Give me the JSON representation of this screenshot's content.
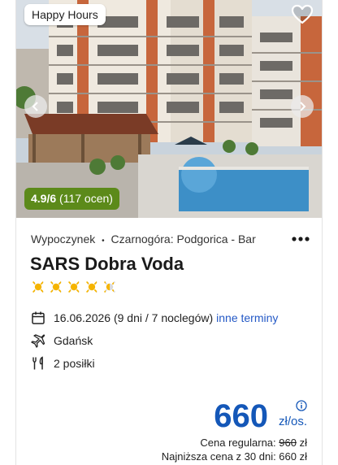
{
  "offer": {
    "badge": "Happy Hours",
    "rating_score": "4.9/6",
    "rating_count": "(117 ocen)",
    "category": "Wypoczynek",
    "separator": "•",
    "location": "Czarnogóra: Podgorica - Bar",
    "hotel_name": "SARS Dobra Voda",
    "sun_rating": 4.5,
    "sun_rating_max": 5,
    "date": "16.06.2026 (9 dni / 7 noclegów)",
    "date_link": "inne terminy",
    "departure": "Gdańsk",
    "meals": "2 posiłki",
    "price": "660",
    "price_unit": "zł/os.",
    "regular_label": "Cena regularna:",
    "regular_price": "960",
    "regular_currency": "zł",
    "lowest_label": "Najniższa cena z 30 dni: 660 zł"
  },
  "colors": {
    "accent": "#1457b8",
    "rating_bg": "#5c8a1a",
    "link": "#2459c6",
    "sun": "#f5b400"
  },
  "icons": {
    "favorite": "heart-icon",
    "prev": "chevron-left-icon",
    "next": "chevron-right-icon",
    "menu": "more-dots-icon",
    "date": "calendar-icon",
    "departure": "plane-icon",
    "meals": "cutlery-icon",
    "info": "info-icon"
  }
}
